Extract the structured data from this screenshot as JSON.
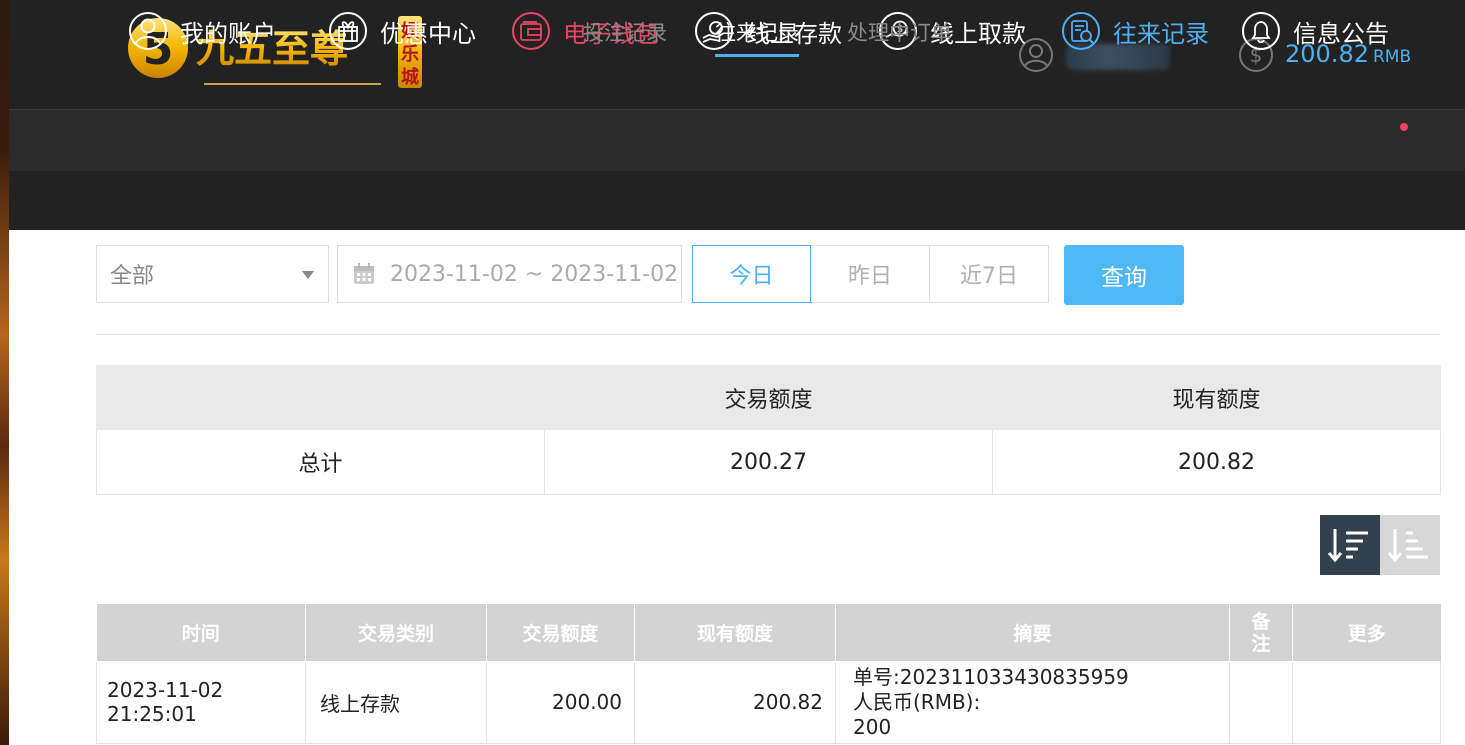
{
  "brand": {
    "name": "九五至尊",
    "badge": "娱乐城",
    "colors": {
      "gold": "#f5b400",
      "dark": "#222222"
    }
  },
  "account": {
    "balance": "200.82",
    "currency": "RMB"
  },
  "nav": {
    "items": [
      {
        "label": "我的账户",
        "icon": "user-circle-icon"
      },
      {
        "label": "优惠中心",
        "icon": "gift-icon"
      },
      {
        "label": "电子钱包",
        "icon": "wallet-icon"
      },
      {
        "label": "线上存款",
        "icon": "deposit-icon"
      },
      {
        "label": "线上取款",
        "icon": "withdraw-icon"
      },
      {
        "label": "往来记录",
        "icon": "records-icon"
      },
      {
        "label": "信息公告",
        "icon": "bell-icon"
      }
    ],
    "active_color": "#4db0f3",
    "highlight_color": "#ee4261"
  },
  "subnav": {
    "items": [
      "投注记录",
      "往来记录",
      "处理中订单"
    ],
    "active": "往来记录"
  },
  "filter": {
    "category": "全部",
    "date_range": "2023-11-02 ~ 2023-11-02",
    "quick": [
      "今日",
      "昨日",
      "近7日"
    ],
    "active_quick": "今日",
    "query_label": "查询"
  },
  "summary": {
    "headers": [
      "",
      "交易额度",
      "现有额度"
    ],
    "total_label": "总计",
    "transaction_total": "200.27",
    "current_total": "200.82"
  },
  "records": {
    "headers": [
      "时间",
      "交易类别",
      "交易额度",
      "现有额度",
      "摘要",
      "备",
      "注",
      "更多"
    ],
    "rows": [
      {
        "time": "2023-11-02 21:25:01",
        "type": "线上存款",
        "amount": "200.00",
        "balance": "200.82",
        "summary_line1": "单号:202311033430835959",
        "summary_line2": "人民币(RMB):",
        "summary_line3": "200",
        "note": "",
        "more": ""
      }
    ]
  }
}
